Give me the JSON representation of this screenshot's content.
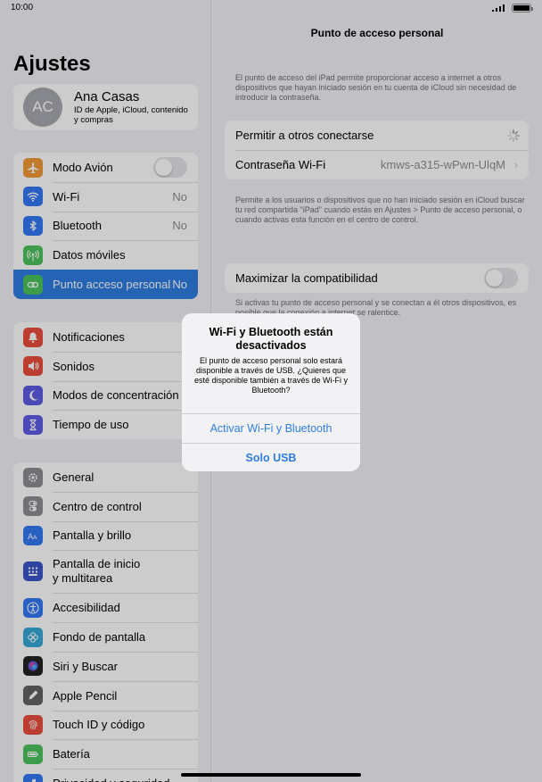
{
  "status": {
    "time": "10:00"
  },
  "sidebar": {
    "title": "Ajustes",
    "profile": {
      "initials": "AC",
      "name": "Ana Casas",
      "subtitle": "ID de Apple, iCloud, contenido y compras"
    },
    "group1": [
      {
        "label": "Modo Avión",
        "value": "",
        "icon": "airplane-icon",
        "color": "#f19a37",
        "toggle": true
      },
      {
        "label": "Wi-Fi",
        "value": "No",
        "icon": "wifi-icon",
        "color": "#3478f6"
      },
      {
        "label": "Bluetooth",
        "value": "No",
        "icon": "bluetooth-icon",
        "color": "#3478f6"
      },
      {
        "label": "Datos móviles",
        "value": "",
        "icon": "antenna-icon",
        "color": "#4dc45d"
      },
      {
        "label": "Punto acceso personal",
        "value": "No",
        "icon": "hotspot-icon",
        "color": "#4dc45d",
        "selected": true
      }
    ],
    "group2": [
      {
        "label": "Notificaciones",
        "icon": "notifications-icon",
        "color": "#eb4e3d"
      },
      {
        "label": "Sonidos",
        "icon": "speaker-icon",
        "color": "#eb4e3d"
      },
      {
        "label": "Modos de concentración",
        "icon": "moon-icon",
        "color": "#5e5ce6"
      },
      {
        "label": "Tiempo de uso",
        "icon": "hourglass-icon",
        "color": "#5e5ce6"
      }
    ],
    "group3": [
      {
        "label": "General",
        "icon": "gear-icon",
        "color": "#8e8e93"
      },
      {
        "label": "Centro de control",
        "icon": "switches-icon",
        "color": "#8e8e93"
      },
      {
        "label": "Pantalla y brillo",
        "icon": "text-size-icon",
        "color": "#3478f6"
      },
      {
        "label": "Pantalla de inicio y multitarea",
        "line1": "Pantalla de inicio",
        "line2": "y multitarea",
        "icon": "grid-icon",
        "color": "#3b55c8"
      },
      {
        "label": "Accesibilidad",
        "icon": "accessibility-icon",
        "color": "#3478f6"
      },
      {
        "label": "Fondo de pantalla",
        "icon": "flower-icon",
        "color": "#35a9d6"
      },
      {
        "label": "Siri y Buscar",
        "icon": "siri-icon",
        "color": "#222222"
      },
      {
        "label": "Apple Pencil",
        "icon": "pencil-icon",
        "color": "#636366"
      },
      {
        "label": "Touch ID y código",
        "icon": "fingerprint-icon",
        "color": "#eb4e3d"
      },
      {
        "label": "Batería",
        "icon": "battery-icon",
        "color": "#4dc45d"
      },
      {
        "label": "Privacidad y seguridad",
        "icon": "hand-icon",
        "color": "#3478f6"
      }
    ]
  },
  "detail": {
    "title": "Punto de acceso personal",
    "intro": "El punto de acceso del iPad permite proporcionar acceso a internet a otros dispositivos que hayan iniciado sesión en tu cuenta de iCloud sin necesidad de introducir la contraseña.",
    "allow_label": "Permitir a otros conectarse",
    "password_label": "Contraseña Wi-Fi",
    "password_value": "kmws-a315-wPwn-UlqM",
    "mid_note": "Permite a los usuarios o dispositivos que no han iniciado sesión en iCloud buscar tu red compartida \"iPad\" cuando estás en Ajustes > Punto de acceso personal, o cuando activas esta función en el centro de control.",
    "compat_label": "Maximizar la compatibilidad",
    "compat_note": "Si activas tu punto de acceso personal y se conectan a él otros dispositivos, es posible que la conexión a internet se ralentice."
  },
  "alert": {
    "title": "Wi-Fi y Bluetooth están desactivados",
    "message": "El punto de acceso personal solo estará disponible a través de USB. ¿Quieres que esté disponible también a través de Wi-Fi y Bluetooth?",
    "button_primary": "Activar Wi-Fi y Bluetooth",
    "button_secondary": "Solo USB"
  }
}
